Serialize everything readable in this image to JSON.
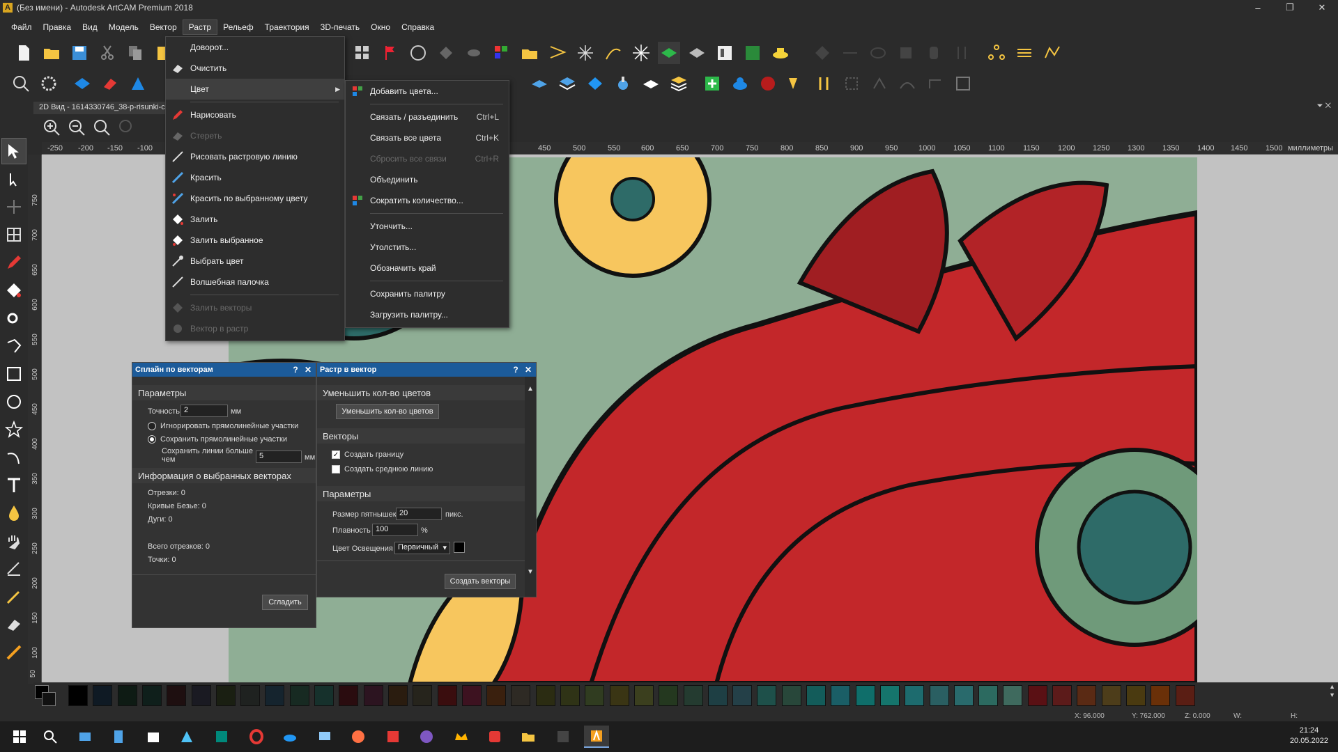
{
  "window": {
    "title": "(Без имени) - Autodesk ArtCAM Premium 2018",
    "app_icon_letter": "A",
    "controls": [
      "–",
      "❐",
      "✕"
    ]
  },
  "menubar": {
    "items": [
      "Файл",
      "Правка",
      "Вид",
      "Модель",
      "Вектор",
      "Растр",
      "Рельеф",
      "Траектория",
      "3D-печать",
      "Окно",
      "Справка"
    ],
    "active": "Растр"
  },
  "doc_tab": {
    "label": "2D Вид - 1614330746_38-p-risunki-c"
  },
  "ruler": {
    "ticks": [
      "-250",
      "-200",
      "-150",
      "-100",
      "450",
      "500",
      "550",
      "600",
      "650",
      "700",
      "750",
      "800",
      "850",
      "900",
      "950",
      "1000",
      "1050",
      "1100",
      "1150",
      "1200",
      "1250",
      "1300",
      "1350",
      "1400",
      "1450",
      "1500"
    ],
    "unit": "миллиметры",
    "vticks": [
      "750",
      "700",
      "650",
      "600",
      "550",
      "500",
      "450",
      "400",
      "350",
      "300",
      "250",
      "200",
      "150",
      "100",
      "50"
    ]
  },
  "raster_menu": {
    "items": [
      {
        "label": "Доворот...",
        "disabled": false,
        "icon": "rotate-icon"
      },
      {
        "label": "Очистить",
        "disabled": false,
        "icon": "eraser-icon"
      },
      {
        "label": "Цвет",
        "disabled": false,
        "icon": "",
        "submenu": true
      },
      {
        "label": "Нарисовать",
        "disabled": false,
        "icon": "pencil-icon"
      },
      {
        "label": "Стереть",
        "disabled": true,
        "icon": "eraser-icon"
      },
      {
        "label": "Рисовать растровую линию",
        "disabled": false,
        "icon": "line-icon"
      },
      {
        "label": "Красить",
        "disabled": false,
        "icon": "brush-icon"
      },
      {
        "label": "Красить по выбранному цвету",
        "disabled": false,
        "icon": "brush-color-icon"
      },
      {
        "label": "Залить",
        "disabled": false,
        "icon": "fill-icon"
      },
      {
        "label": "Залить выбранное",
        "disabled": false,
        "icon": "fill-selected-icon"
      },
      {
        "label": "Выбрать цвет",
        "disabled": false,
        "icon": "eyedropper-icon"
      },
      {
        "label": "Волшебная палочка",
        "disabled": false,
        "icon": "magic-wand-icon"
      },
      {
        "label": "Залить векторы",
        "disabled": true,
        "icon": "fill-vectors-icon"
      },
      {
        "label": "Вектор в растр",
        "disabled": true,
        "icon": "vector-to-raster-icon"
      }
    ]
  },
  "color_submenu": {
    "items": [
      {
        "label": "Добавить цвета...",
        "shortcut": "",
        "disabled": false
      },
      {
        "label": "Связать / разъединить",
        "shortcut": "Ctrl+L",
        "disabled": false
      },
      {
        "label": "Связать все цвета",
        "shortcut": "Ctrl+K",
        "disabled": false
      },
      {
        "label": "Сбросить все связи",
        "shortcut": "Ctrl+R",
        "disabled": true
      },
      {
        "label": "Объединить",
        "shortcut": "",
        "disabled": false
      },
      {
        "label": "Сократить количество...",
        "shortcut": "",
        "disabled": false
      },
      {
        "label": "Утончить...",
        "shortcut": "",
        "disabled": false
      },
      {
        "label": "Утолстить...",
        "shortcut": "",
        "disabled": false
      },
      {
        "label": "Обозначить край",
        "shortcut": "",
        "disabled": false
      },
      {
        "label": "Сохранить палитру",
        "shortcut": "",
        "disabled": false
      },
      {
        "label": "Загрузить палитру...",
        "shortcut": "",
        "disabled": false
      }
    ]
  },
  "spline_panel": {
    "title": "Сплайн по векторам",
    "help": "?",
    "close": "✕",
    "params_header": "Параметры",
    "tolerance_label": "Точность",
    "tolerance_value": "2",
    "tolerance_unit": "мм",
    "radio_ignore": "Игнорировать прямолинейные участки",
    "radio_keep": "Сохранить прямолинейные участки",
    "keep_lines_label_1": "Сохранить линии больше",
    "keep_lines_label_2": "чем",
    "keep_lines_value": "5",
    "keep_lines_unit": "мм",
    "info_header": "Информация о выбранных векторах",
    "segments": "Отрезки: 0",
    "bezier": "Кривые Безье: 0",
    "arcs": "Дуги: 0",
    "total_segments": "Всего отрезков: 0",
    "points": "Точки: 0",
    "smooth_button": "Сгладить"
  },
  "raster_to_vector_panel": {
    "title": "Растр в вектор",
    "help": "?",
    "close": "✕",
    "reduce_header": "Уменьшить кол-во цветов",
    "reduce_button": "Уменьшить кол-во цветов",
    "vectors_header": "Векторы",
    "create_border": "Создать границу",
    "create_border_checked": true,
    "create_centerline": "Создать среднюю линию",
    "create_centerline_checked": false,
    "params_header": "Параметры",
    "speckle_label": "Размер пятнышек",
    "speckle_value": "20",
    "speckle_unit": "пикс.",
    "smoothness_label": "Плавность",
    "smoothness_value": "100",
    "smoothness_unit": "%",
    "light_color_label": "Цвет Освещения",
    "light_color_value": "Первичный",
    "create_button": "Создать векторы"
  },
  "palette": {
    "colors": [
      "#000000",
      "#0f1a24",
      "#0e1b14",
      "#0f1f1b",
      "#1e0f10",
      "#1a1a22",
      "#1a1f12",
      "#1f2220",
      "#15242e",
      "#172a22",
      "#16312c",
      "#2a0c0f",
      "#2c1420",
      "#2a1c0f",
      "#26241c",
      "#3a0d0e",
      "#3d1220",
      "#3a200e",
      "#2e2a24",
      "#2b2c12",
      "#2f3316",
      "#303c20",
      "#3a3514",
      "#3b3f1e",
      "#24381f",
      "#243b30",
      "#1e3f44",
      "#244048",
      "#1e504a",
      "#28473a",
      "#135c5a",
      "#1a5e66",
      "#0f6e6a",
      "#15756c",
      "#1d6b6e",
      "#2a5f62",
      "#296a6c",
      "#2c6a60",
      "#3f6a5e",
      "#5a1014",
      "#5c1b1a",
      "#5a2a14",
      "#4d3d1a",
      "#4a3a10",
      "#6a3008",
      "#5a1e14"
    ]
  },
  "status": {
    "x": "X: 96.000",
    "y": "Y: 762.000",
    "z": "Z: 0.000",
    "w": "W:",
    "h": "H:"
  },
  "taskbar": {
    "time": "21:24",
    "date": "20.05.2022"
  },
  "colors": {
    "accent": "#1c5b9a",
    "bg": "#2b2b2b",
    "canvas": "#c2c2c2"
  }
}
